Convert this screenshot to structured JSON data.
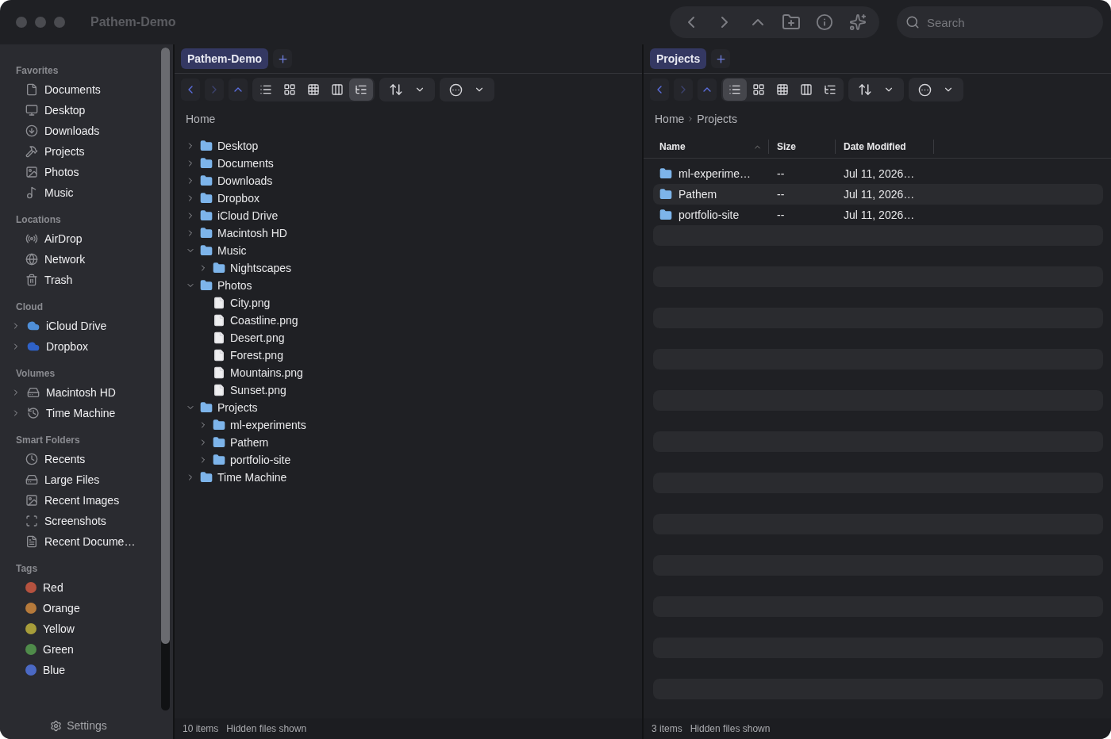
{
  "window": {
    "title": "Pathem-Demo"
  },
  "search": {
    "placeholder": "Search"
  },
  "sidebar": {
    "sections": [
      {
        "title": "Favorites",
        "items": [
          {
            "label": "Documents"
          },
          {
            "label": "Desktop"
          },
          {
            "label": "Downloads"
          },
          {
            "label": "Projects"
          },
          {
            "label": "Photos"
          },
          {
            "label": "Music"
          }
        ]
      },
      {
        "title": "Locations",
        "items": [
          {
            "label": "AirDrop"
          },
          {
            "label": "Network"
          },
          {
            "label": "Trash"
          }
        ]
      },
      {
        "title": "Cloud",
        "items": [
          {
            "label": "iCloud Drive",
            "expanded": false
          },
          {
            "label": "Dropbox",
            "expanded": false
          }
        ]
      },
      {
        "title": "Volumes",
        "items": [
          {
            "label": "Macintosh HD",
            "expanded": false
          },
          {
            "label": "Time Machine",
            "expanded": false
          }
        ]
      },
      {
        "title": "Smart Folders",
        "items": [
          {
            "label": "Recents"
          },
          {
            "label": "Large Files"
          },
          {
            "label": "Recent Images"
          },
          {
            "label": "Screenshots"
          },
          {
            "label": "Recent Docume…"
          }
        ]
      },
      {
        "title": "Tags",
        "items": [
          {
            "label": "Red",
            "color": "#b5523f"
          },
          {
            "label": "Orange",
            "color": "#b67a3b"
          },
          {
            "label": "Yellow",
            "color": "#a79d3a"
          },
          {
            "label": "Green",
            "color": "#4f8b4a"
          },
          {
            "label": "Blue",
            "color": "#4b69c4"
          }
        ]
      }
    ],
    "footer": "Settings"
  },
  "panes": [
    {
      "tabs": [
        {
          "label": "Pathem-Demo",
          "selected": true
        }
      ],
      "nav": [
        {
          "disabled": false
        },
        {
          "disabled": true
        },
        {
          "disabled": false
        }
      ],
      "view_modes": [
        {
          "selected": false
        },
        {
          "selected": false
        },
        {
          "selected": false
        },
        {
          "selected": false
        },
        {
          "selected": true
        }
      ],
      "path": [
        "Home"
      ],
      "kind": "tree",
      "tree": [
        {
          "label": "Desktop",
          "kind": "folder",
          "expanded": false
        },
        {
          "label": "Documents",
          "kind": "folder",
          "expanded": false
        },
        {
          "label": "Downloads",
          "kind": "folder",
          "expanded": false
        },
        {
          "label": "Dropbox",
          "kind": "folder",
          "expanded": false
        },
        {
          "label": "iCloud Drive",
          "kind": "folder",
          "expanded": false
        },
        {
          "label": "Macintosh HD",
          "kind": "folder",
          "expanded": false
        },
        {
          "label": "Music",
          "kind": "folder",
          "expanded": true,
          "children": [
            {
              "label": "Nightscapes",
              "kind": "folder",
              "expanded": false
            }
          ]
        },
        {
          "label": "Photos",
          "kind": "folder",
          "expanded": true,
          "children": [
            {
              "label": "City.png",
              "kind": "file"
            },
            {
              "label": "Coastline.png",
              "kind": "file"
            },
            {
              "label": "Desert.png",
              "kind": "file"
            },
            {
              "label": "Forest.png",
              "kind": "file"
            },
            {
              "label": "Mountains.png",
              "kind": "file"
            },
            {
              "label": "Sunset.png",
              "kind": "file"
            }
          ]
        },
        {
          "label": "Projects",
          "kind": "folder",
          "expanded": true,
          "children": [
            {
              "label": "ml-experiments",
              "kind": "folder",
              "expanded": false
            },
            {
              "label": "Pathem",
              "kind": "folder",
              "expanded": false
            },
            {
              "label": "portfolio-site",
              "kind": "folder",
              "expanded": false
            }
          ]
        },
        {
          "label": "Time Machine",
          "kind": "folder",
          "expanded": false
        }
      ],
      "status": [
        "10 items",
        "Hidden files shown"
      ]
    },
    {
      "tabs": [
        {
          "label": "Projects",
          "selected": true
        }
      ],
      "nav": [
        {
          "disabled": false
        },
        {
          "disabled": true
        },
        {
          "disabled": false
        }
      ],
      "view_modes": [
        {
          "selected": true
        },
        {
          "selected": false
        },
        {
          "selected": false
        },
        {
          "selected": false
        },
        {
          "selected": false
        }
      ],
      "path": [
        "Home",
        "Projects"
      ],
      "kind": "table",
      "table": {
        "columns": [
          {
            "label": "Name",
            "sort_ascending": true
          },
          {
            "label": "Size"
          },
          {
            "label": "Date Modified"
          }
        ],
        "rows": [
          {
            "name": "ml-experime…",
            "size": "--",
            "date": "Jul 11, 2026…"
          },
          {
            "name": "Pathem",
            "size": "--",
            "date": "Jul 11, 2026…"
          },
          {
            "name": "portfolio-site",
            "size": "--",
            "date": "Jul 11, 2026…"
          }
        ]
      },
      "status": [
        "3 items",
        "Hidden files shown"
      ]
    }
  ]
}
